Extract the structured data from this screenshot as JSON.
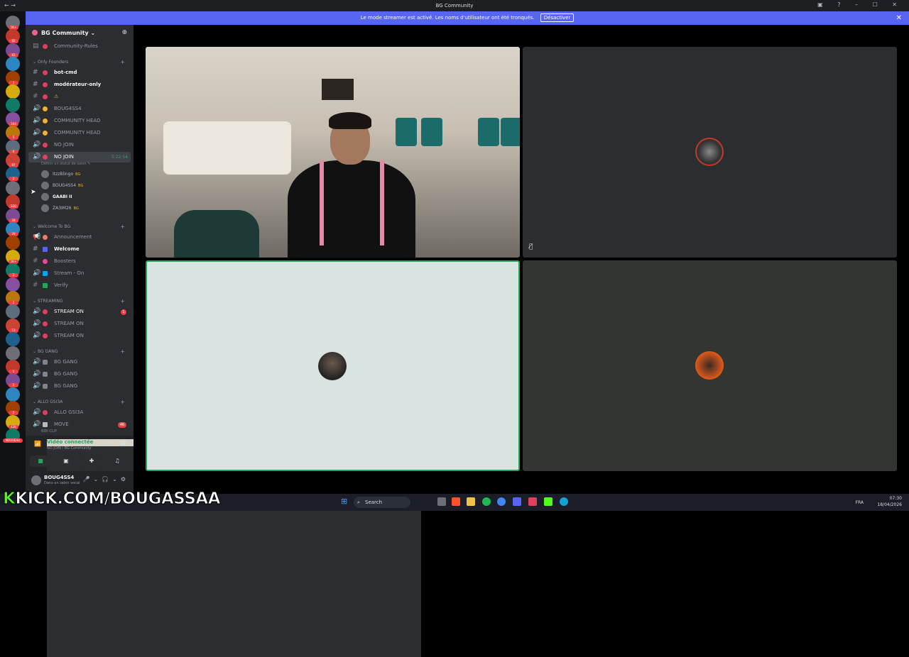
{
  "window": {
    "title": "BG Community",
    "nav": "← →",
    "controls": "▣ ? – ☐ ✕"
  },
  "banner": {
    "text": "Le mode streamer est activé. Les noms d'utilisateur ont été tronqués.",
    "button": "Désactiver",
    "close": "✕"
  },
  "server": {
    "name": "BG Community",
    "chevron": "⌄",
    "invite_icon": "person-add-icon"
  },
  "guild_badges": [
    "1K+",
    "82",
    "83",
    "",
    "3",
    "",
    "",
    "344",
    "5",
    "6",
    "87",
    "2",
    "",
    "330",
    "28",
    "29",
    "",
    "1K+",
    "2",
    "",
    "2",
    "",
    "12",
    "",
    "",
    "1",
    "2",
    "",
    "2",
    "426",
    "NOUVEAU"
  ],
  "channels": {
    "rules": "Community-Rules",
    "cat_founders": "Only Founders",
    "bot_cmd": "bot-cmd",
    "moderateur": "modérateur-only",
    "warn": "⚠",
    "boug": "BOUG4SS4",
    "comhead1": "COMMUNITY HEAD",
    "comhead2": "COMMUNITY HEAD",
    "nojoin1": "NO JOIN",
    "nojoin2": "NO JOIN",
    "nojoin_time": "5:22:54",
    "status_hint": "Définir un statut de salon ✎",
    "cat_welcome": "Welcome To BG",
    "announce": "Announcement",
    "welcome": "Welcome",
    "boosters": "Boosters",
    "streamon": "Stream - On",
    "verify": "Verify",
    "cat_streaming": "STREAMING",
    "stream1": "STREAM ON",
    "stream1_badge": "1",
    "stream2": "STREAM ON",
    "stream3": "STREAM ON",
    "cat_gang": "BG GANG",
    "gang1": "BG GANG",
    "gang2": "BG GANG",
    "gang3": "BG GANG",
    "cat_allo": "ALLO GSI3A",
    "allo": "ALLO GSI3A",
    "move": "MOVE",
    "move_badge": "46",
    "move_sub": "BIBI CLIP"
  },
  "voice_users": [
    {
      "name": "ItzzBlingo",
      "tag": "BG"
    },
    {
      "name": "BOUG4SS4",
      "tag": "BG"
    },
    {
      "name": "GAABI II",
      "tag": ""
    },
    {
      "name": "ZA3IM26",
      "tag": "BG"
    }
  ],
  "voice_panel": {
    "status": "Vidéo connectée",
    "location": "NO JOIN / BG Community"
  },
  "user_panel": {
    "name": "BOUG4SS4",
    "status": "Dans un salon vocal"
  },
  "overlay": {
    "kick_prefix": "K",
    "kick_text": "KICK.COM/BOUGASSAA"
  },
  "taskbar": {
    "search": "Search",
    "lang": "FRA",
    "time": "07:30",
    "date": "18/04/2026"
  }
}
